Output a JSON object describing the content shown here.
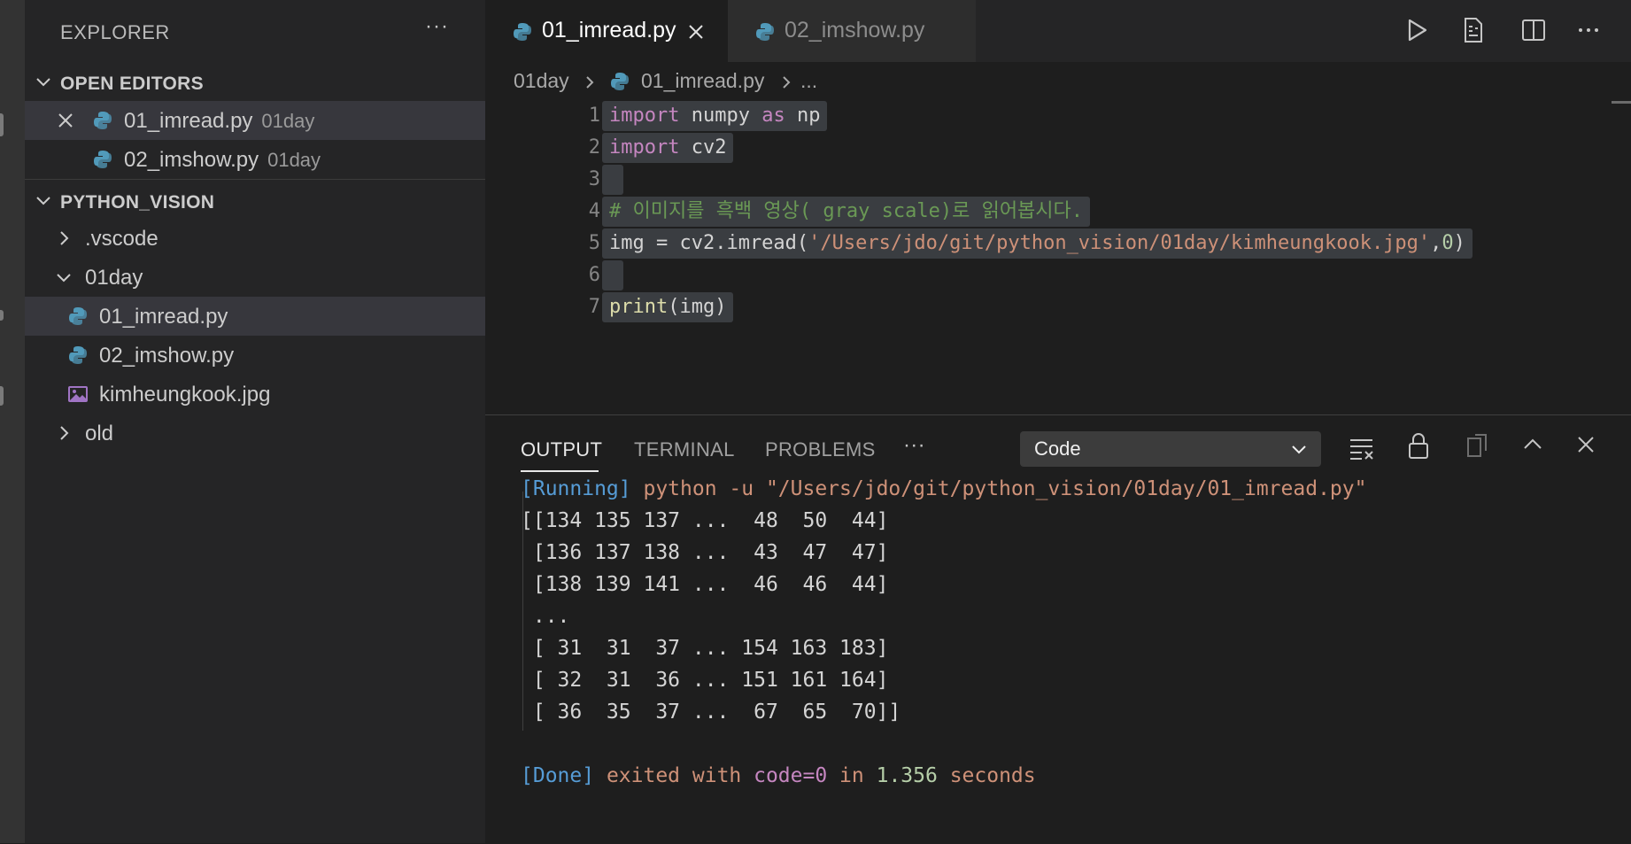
{
  "sidebar": {
    "title": "EXPLORER",
    "more": "···",
    "open_editors": {
      "label": "OPEN EDITORS",
      "items": [
        {
          "name": "01_imread.py",
          "folder": "01day"
        },
        {
          "name": "02_imshow.py",
          "folder": "01day"
        }
      ]
    },
    "project": {
      "label": "PYTHON_VISION",
      "items": [
        {
          "name": ".vscode"
        },
        {
          "name": "01day"
        },
        {
          "name": "01_imread.py"
        },
        {
          "name": "02_imshow.py"
        },
        {
          "name": "kimheungkook.jpg"
        },
        {
          "name": "old"
        }
      ]
    }
  },
  "tabs": [
    {
      "label": "01_imread.py"
    },
    {
      "label": "02_imshow.py"
    }
  ],
  "breadcrumb": {
    "folder": "01day",
    "file": "01_imread.py",
    "more": "..."
  },
  "editor": {
    "line_numbers": [
      "1",
      "2",
      "3",
      "4",
      "5",
      "6",
      "7"
    ],
    "lines": {
      "l1": {
        "kw1": "import",
        "mod": " numpy ",
        "kw2": "as",
        "alias": " np"
      },
      "l2": {
        "kw": "import",
        "mod": " cv2"
      },
      "l4": {
        "comment": "# 이미지를 흑백 영상( gray scale)로 읽어봅시다."
      },
      "l5": {
        "pre": "img = cv2.imread(",
        "str": "'/Users/jdo/git/python_vision/01day/kimheungkook.jpg'",
        "comma": ",",
        "num": "0",
        "close": ")"
      },
      "l7": {
        "fn": "print",
        "args": "(img)"
      }
    }
  },
  "panel": {
    "tabs": [
      "OUTPUT",
      "TERMINAL",
      "PROBLEMS"
    ],
    "more": "···",
    "channel": "Code",
    "output": {
      "running_tag": "[Running]",
      "running_cmd": " python -u \"/Users/jdo/git/python_vision/01day/01_imread.py\"",
      "rows": [
        "[[134 135 137 ...  48  50  44]",
        " [136 137 138 ...  43  47  47]",
        " [138 139 141 ...  46  46  44]",
        " ...",
        " [ 31  31  37 ... 154 163 183]",
        " [ 32  31  36 ... 151 161 164]",
        " [ 36  35  37 ...  67  65  70]]"
      ],
      "done_tag": "[Done]",
      "done_text1": " exited with ",
      "done_code": "code=0",
      "done_text2": " in ",
      "done_time": "1.356",
      "done_text3": " seconds"
    }
  }
}
